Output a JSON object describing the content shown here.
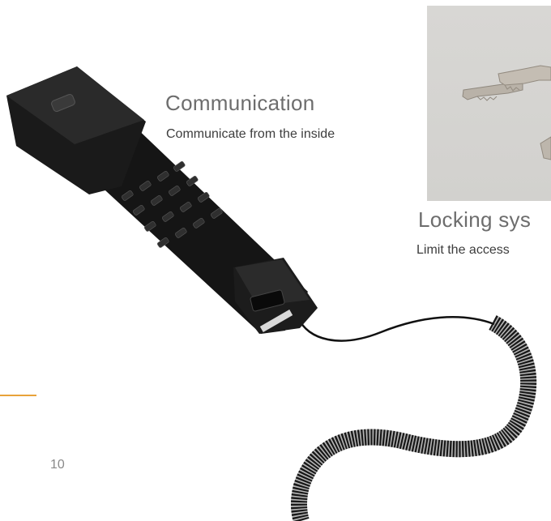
{
  "features": [
    {
      "title": "Communication",
      "subtitle": "Communicate from the inside"
    },
    {
      "title": "Locking sys",
      "subtitle": "Limit the access"
    }
  ],
  "page": {
    "number": "10"
  },
  "colors": {
    "accent": "#e8a23a",
    "heading": "#6d6d6d",
    "body_text": "#3d3d3d",
    "page_number": "#8a8a8a",
    "photo_background": "#d4d3d0",
    "handset": "#141414"
  },
  "icons": [
    "telephone-handset-icon",
    "keys-icon"
  ]
}
